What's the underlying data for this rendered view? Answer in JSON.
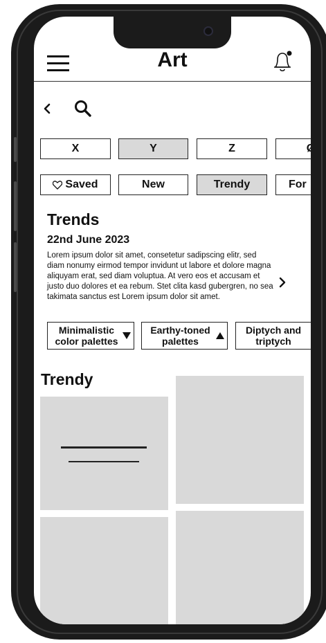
{
  "header": {
    "title": "Art"
  },
  "letter_tabs": [
    {
      "label": "X",
      "selected": false
    },
    {
      "label": "Y",
      "selected": true
    },
    {
      "label": "Z",
      "selected": false
    },
    {
      "label": "Ø",
      "selected": false
    }
  ],
  "filter_tabs": [
    {
      "label": "Saved",
      "selected": false
    },
    {
      "label": "New",
      "selected": false
    },
    {
      "label": "Trendy",
      "selected": true
    },
    {
      "label": "For",
      "selected": false
    }
  ],
  "trends": {
    "heading": "Trends",
    "date": "22nd June 2023",
    "body": "Lorem ipsum dolor sit amet, consetetur sadipscing elitr, sed diam nonumy eirmod tempor invidunt ut labore et dolore magna aliquyam erat, sed diam voluptua. At vero eos et accusam et justo duo dolores et ea rebum. Stet clita kasd gubergren, no sea takimata sanctus est Lorem ipsum dolor sit amet.",
    "tags": [
      {
        "label": "Minimalistic color palettes",
        "arrow": "down"
      },
      {
        "label": "Earthy-toned palettes",
        "arrow": "up"
      },
      {
        "label": "Diptych and triptych",
        "arrow": ""
      }
    ]
  },
  "trendy": {
    "heading": "Trendy"
  },
  "colors": {
    "frame": "#1b1b1b",
    "selected": "#d9d9d9",
    "placeholder": "#d9d9d9"
  }
}
